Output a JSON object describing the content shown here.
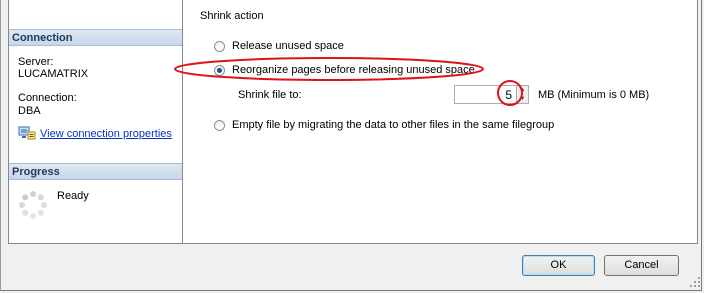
{
  "left": {
    "connection_header": "Connection",
    "server_label": "Server:",
    "server_value": "LUCAMATRIX",
    "connection_label": "Connection:",
    "connection_value": "DBA",
    "view_props_link": "View connection properties",
    "progress_header": "Progress",
    "progress_status": "Ready"
  },
  "shrink": {
    "group_label": "Shrink action",
    "options": [
      {
        "label": "Release unused space",
        "checked": false
      },
      {
        "label": "Reorganize pages before releasing unused space",
        "checked": true
      },
      {
        "label": "Empty file by migrating the data to other files in the same filegroup",
        "checked": false
      }
    ],
    "shrink_file_label": "Shrink file to:",
    "shrink_file_value": "5",
    "unit_label": "MB (Minimum is 0 MB)"
  },
  "buttons": {
    "ok": "OK",
    "cancel": "Cancel"
  },
  "colors": {
    "annotation": "#e0101a",
    "link": "#0033cc",
    "header": "#1e395b"
  },
  "icons": [
    "connection-properties-icon",
    "progress-spinner-icon",
    "spin-up-icon",
    "spin-down-icon"
  ]
}
